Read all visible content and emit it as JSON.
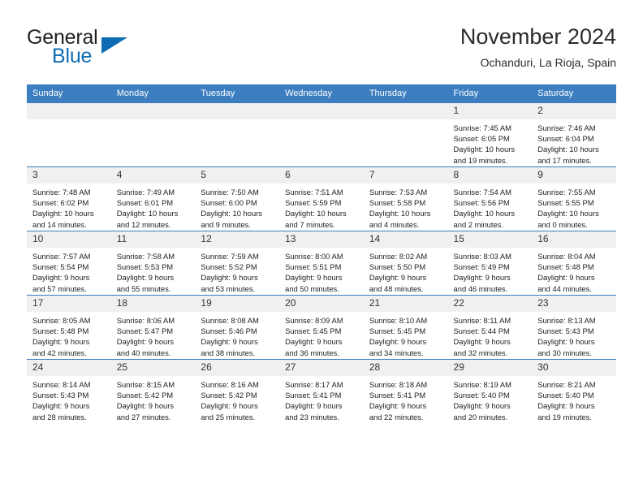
{
  "brand": {
    "name_part1": "General",
    "name_part2": "Blue",
    "logo_icon": "triangle-logo-icon"
  },
  "header": {
    "title": "November 2024",
    "subtitle": "Ochanduri, La Rioja, Spain"
  },
  "colors": {
    "header_blue": "#3c7ebf",
    "brand_blue": "#0c6cb4",
    "daynum_bg": "#f0f0f0",
    "text": "#222222"
  },
  "weekday_headers": [
    "Sunday",
    "Monday",
    "Tuesday",
    "Wednesday",
    "Thursday",
    "Friday",
    "Saturday"
  ],
  "labels": {
    "sunrise_prefix": "Sunrise:",
    "sunset_prefix": "Sunset:",
    "daylight_prefix": "Daylight:"
  },
  "weeks": [
    [
      {
        "empty": true
      },
      {
        "empty": true
      },
      {
        "empty": true
      },
      {
        "empty": true
      },
      {
        "empty": true
      },
      {
        "day": "1",
        "sunrise": "Sunrise: 7:45 AM",
        "sunset": "Sunset: 6:05 PM",
        "daylight_l1": "Daylight: 10 hours",
        "daylight_l2": "and 19 minutes."
      },
      {
        "day": "2",
        "sunrise": "Sunrise: 7:46 AM",
        "sunset": "Sunset: 6:04 PM",
        "daylight_l1": "Daylight: 10 hours",
        "daylight_l2": "and 17 minutes."
      }
    ],
    [
      {
        "day": "3",
        "sunrise": "Sunrise: 7:48 AM",
        "sunset": "Sunset: 6:02 PM",
        "daylight_l1": "Daylight: 10 hours",
        "daylight_l2": "and 14 minutes."
      },
      {
        "day": "4",
        "sunrise": "Sunrise: 7:49 AM",
        "sunset": "Sunset: 6:01 PM",
        "daylight_l1": "Daylight: 10 hours",
        "daylight_l2": "and 12 minutes."
      },
      {
        "day": "5",
        "sunrise": "Sunrise: 7:50 AM",
        "sunset": "Sunset: 6:00 PM",
        "daylight_l1": "Daylight: 10 hours",
        "daylight_l2": "and 9 minutes."
      },
      {
        "day": "6",
        "sunrise": "Sunrise: 7:51 AM",
        "sunset": "Sunset: 5:59 PM",
        "daylight_l1": "Daylight: 10 hours",
        "daylight_l2": "and 7 minutes."
      },
      {
        "day": "7",
        "sunrise": "Sunrise: 7:53 AM",
        "sunset": "Sunset: 5:58 PM",
        "daylight_l1": "Daylight: 10 hours",
        "daylight_l2": "and 4 minutes."
      },
      {
        "day": "8",
        "sunrise": "Sunrise: 7:54 AM",
        "sunset": "Sunset: 5:56 PM",
        "daylight_l1": "Daylight: 10 hours",
        "daylight_l2": "and 2 minutes."
      },
      {
        "day": "9",
        "sunrise": "Sunrise: 7:55 AM",
        "sunset": "Sunset: 5:55 PM",
        "daylight_l1": "Daylight: 10 hours",
        "daylight_l2": "and 0 minutes."
      }
    ],
    [
      {
        "day": "10",
        "sunrise": "Sunrise: 7:57 AM",
        "sunset": "Sunset: 5:54 PM",
        "daylight_l1": "Daylight: 9 hours",
        "daylight_l2": "and 57 minutes."
      },
      {
        "day": "11",
        "sunrise": "Sunrise: 7:58 AM",
        "sunset": "Sunset: 5:53 PM",
        "daylight_l1": "Daylight: 9 hours",
        "daylight_l2": "and 55 minutes."
      },
      {
        "day": "12",
        "sunrise": "Sunrise: 7:59 AM",
        "sunset": "Sunset: 5:52 PM",
        "daylight_l1": "Daylight: 9 hours",
        "daylight_l2": "and 53 minutes."
      },
      {
        "day": "13",
        "sunrise": "Sunrise: 8:00 AM",
        "sunset": "Sunset: 5:51 PM",
        "daylight_l1": "Daylight: 9 hours",
        "daylight_l2": "and 50 minutes."
      },
      {
        "day": "14",
        "sunrise": "Sunrise: 8:02 AM",
        "sunset": "Sunset: 5:50 PM",
        "daylight_l1": "Daylight: 9 hours",
        "daylight_l2": "and 48 minutes."
      },
      {
        "day": "15",
        "sunrise": "Sunrise: 8:03 AM",
        "sunset": "Sunset: 5:49 PM",
        "daylight_l1": "Daylight: 9 hours",
        "daylight_l2": "and 46 minutes."
      },
      {
        "day": "16",
        "sunrise": "Sunrise: 8:04 AM",
        "sunset": "Sunset: 5:48 PM",
        "daylight_l1": "Daylight: 9 hours",
        "daylight_l2": "and 44 minutes."
      }
    ],
    [
      {
        "day": "17",
        "sunrise": "Sunrise: 8:05 AM",
        "sunset": "Sunset: 5:48 PM",
        "daylight_l1": "Daylight: 9 hours",
        "daylight_l2": "and 42 minutes."
      },
      {
        "day": "18",
        "sunrise": "Sunrise: 8:06 AM",
        "sunset": "Sunset: 5:47 PM",
        "daylight_l1": "Daylight: 9 hours",
        "daylight_l2": "and 40 minutes."
      },
      {
        "day": "19",
        "sunrise": "Sunrise: 8:08 AM",
        "sunset": "Sunset: 5:46 PM",
        "daylight_l1": "Daylight: 9 hours",
        "daylight_l2": "and 38 minutes."
      },
      {
        "day": "20",
        "sunrise": "Sunrise: 8:09 AM",
        "sunset": "Sunset: 5:45 PM",
        "daylight_l1": "Daylight: 9 hours",
        "daylight_l2": "and 36 minutes."
      },
      {
        "day": "21",
        "sunrise": "Sunrise: 8:10 AM",
        "sunset": "Sunset: 5:45 PM",
        "daylight_l1": "Daylight: 9 hours",
        "daylight_l2": "and 34 minutes."
      },
      {
        "day": "22",
        "sunrise": "Sunrise: 8:11 AM",
        "sunset": "Sunset: 5:44 PM",
        "daylight_l1": "Daylight: 9 hours",
        "daylight_l2": "and 32 minutes."
      },
      {
        "day": "23",
        "sunrise": "Sunrise: 8:13 AM",
        "sunset": "Sunset: 5:43 PM",
        "daylight_l1": "Daylight: 9 hours",
        "daylight_l2": "and 30 minutes."
      }
    ],
    [
      {
        "day": "24",
        "sunrise": "Sunrise: 8:14 AM",
        "sunset": "Sunset: 5:43 PM",
        "daylight_l1": "Daylight: 9 hours",
        "daylight_l2": "and 28 minutes."
      },
      {
        "day": "25",
        "sunrise": "Sunrise: 8:15 AM",
        "sunset": "Sunset: 5:42 PM",
        "daylight_l1": "Daylight: 9 hours",
        "daylight_l2": "and 27 minutes."
      },
      {
        "day": "26",
        "sunrise": "Sunrise: 8:16 AM",
        "sunset": "Sunset: 5:42 PM",
        "daylight_l1": "Daylight: 9 hours",
        "daylight_l2": "and 25 minutes."
      },
      {
        "day": "27",
        "sunrise": "Sunrise: 8:17 AM",
        "sunset": "Sunset: 5:41 PM",
        "daylight_l1": "Daylight: 9 hours",
        "daylight_l2": "and 23 minutes."
      },
      {
        "day": "28",
        "sunrise": "Sunrise: 8:18 AM",
        "sunset": "Sunset: 5:41 PM",
        "daylight_l1": "Daylight: 9 hours",
        "daylight_l2": "and 22 minutes."
      },
      {
        "day": "29",
        "sunrise": "Sunrise: 8:19 AM",
        "sunset": "Sunset: 5:40 PM",
        "daylight_l1": "Daylight: 9 hours",
        "daylight_l2": "and 20 minutes."
      },
      {
        "day": "30",
        "sunrise": "Sunrise: 8:21 AM",
        "sunset": "Sunset: 5:40 PM",
        "daylight_l1": "Daylight: 9 hours",
        "daylight_l2": "and 19 minutes."
      }
    ]
  ]
}
